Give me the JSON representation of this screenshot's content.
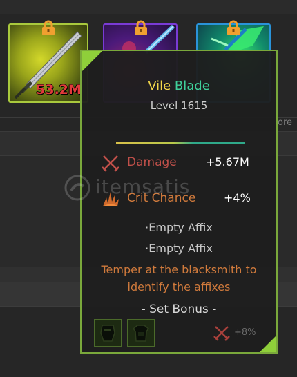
{
  "inventory": {
    "slots": [
      {
        "rarity_color": "#a9c93d",
        "weapon_icon": "sword-icon",
        "locked": true,
        "value_text": "53.2M"
      },
      {
        "rarity_color": "#7a3bd6",
        "weapon_icon": "sword-icon",
        "locked": true
      },
      {
        "rarity_color": "#2a93d9",
        "weapon_icon": "blade-icon",
        "locked": true
      }
    ],
    "edge_text": "ore"
  },
  "tooltip": {
    "name_part1": "Vile",
    "name_part2": "Blade",
    "name_colors": {
      "part1": "#f2d64a",
      "part2": "#3fcf9a"
    },
    "level": "Level 1615",
    "stats": [
      {
        "icon": "crossed-swords-icon",
        "name": "Damage",
        "value": "+5.67M",
        "color": "#c0504a"
      },
      {
        "icon": "crit-burst-icon",
        "name": "Crit Chance",
        "value": "+4%",
        "color": "#d07a3c"
      }
    ],
    "affixes": [
      "·Empty Affix",
      "·Empty Affix"
    ],
    "temper_note": "Temper at the blacksmith to identify the affixes",
    "set_bonus_header": "- Set Bonus -",
    "set_pieces": [
      "helmet-icon",
      "chest-armor-icon"
    ],
    "set_bonus": {
      "icon": "crossed-swords-icon",
      "value": "+8%"
    }
  },
  "watermark": {
    "text": "itemsatis",
    "icon": "itemsatis-logo-icon"
  }
}
